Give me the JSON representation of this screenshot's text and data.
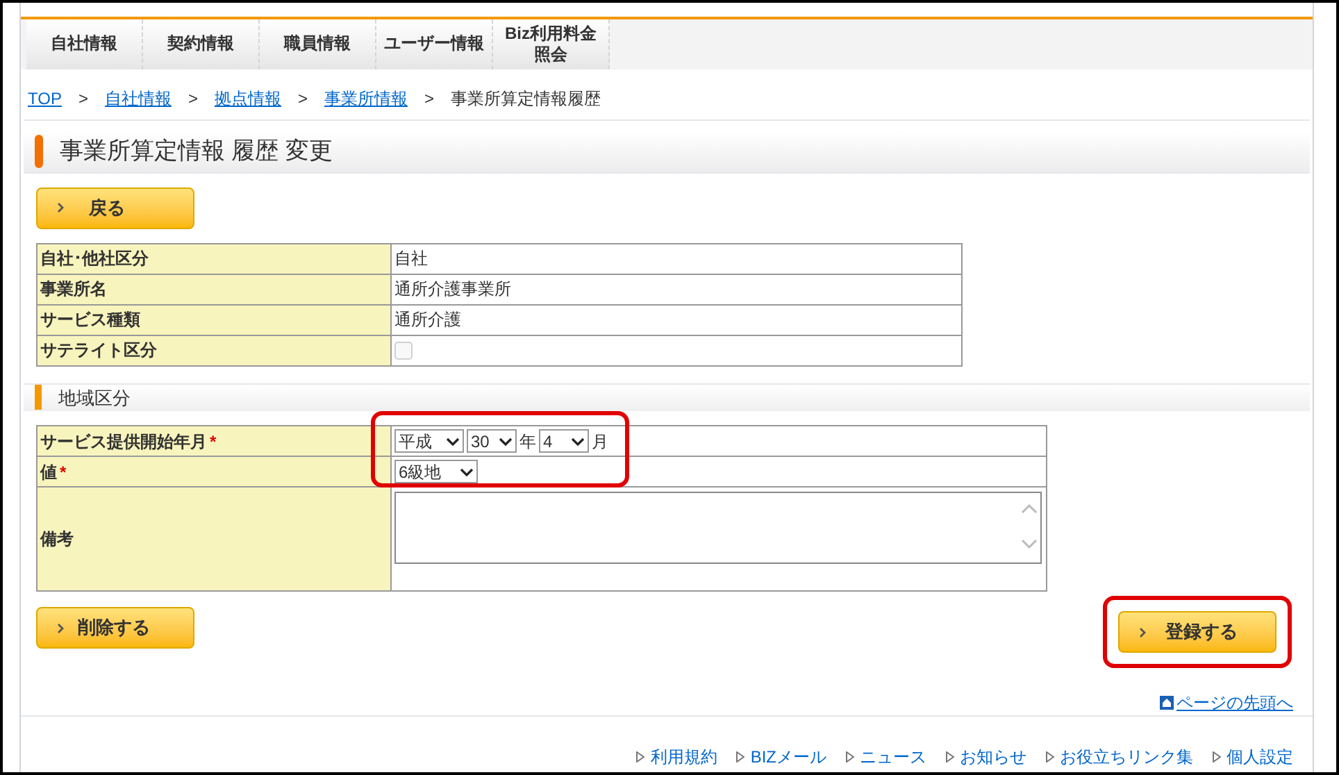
{
  "nav_tabs": [
    {
      "label": "自社情報",
      "selected": false
    },
    {
      "label": "契約情報",
      "selected": false
    },
    {
      "label": "職員情報",
      "selected": false
    },
    {
      "label": "ユーザー情報",
      "selected": false
    },
    {
      "label": "Biz利用料金照会",
      "selected": false
    }
  ],
  "breadcrumb": [
    {
      "label": "TOP",
      "link": true
    },
    {
      "label": "自社情報",
      "link": true
    },
    {
      "label": "拠点情報",
      "link": true
    },
    {
      "label": "事業所情報",
      "link": true
    },
    {
      "label": "事業所算定情報履歴",
      "link": false
    }
  ],
  "breadcrumb_separator": ">",
  "page_title": "事業所算定情報 履歴 変更",
  "back_button": "戻る",
  "info_table": [
    {
      "label": "自社･他社区分",
      "kind": "text",
      "value": "自社"
    },
    {
      "label": "事業所名",
      "kind": "text",
      "value": "通所介護事業所"
    },
    {
      "label": "サービス種類",
      "kind": "text",
      "value": "通所介護"
    },
    {
      "label": "サテライト区分",
      "kind": "checkbox",
      "checked": false,
      "disabled": true
    }
  ],
  "section_title": "地域区分",
  "region_form": {
    "highlighted": true,
    "rows": [
      {
        "label": "サービス提供開始年月",
        "required": true,
        "kind": "date",
        "era": "平成",
        "year": "30",
        "year_unit": "年",
        "month": "4",
        "month_unit": "月"
      },
      {
        "label": "値",
        "required": true,
        "kind": "select",
        "value": "6級地"
      },
      {
        "label": "備考",
        "required": false,
        "kind": "textarea"
      }
    ]
  },
  "required_mark": "*",
  "delete_button": "削除する",
  "register_button": {
    "label": "登録する",
    "highlighted": true
  },
  "page_top_link": "ページの先頭へ",
  "footer_links": [
    "利用規約",
    "BIZメール",
    "ニュース",
    "お知らせ",
    "お役立ちリンク集",
    "個人設定"
  ]
}
